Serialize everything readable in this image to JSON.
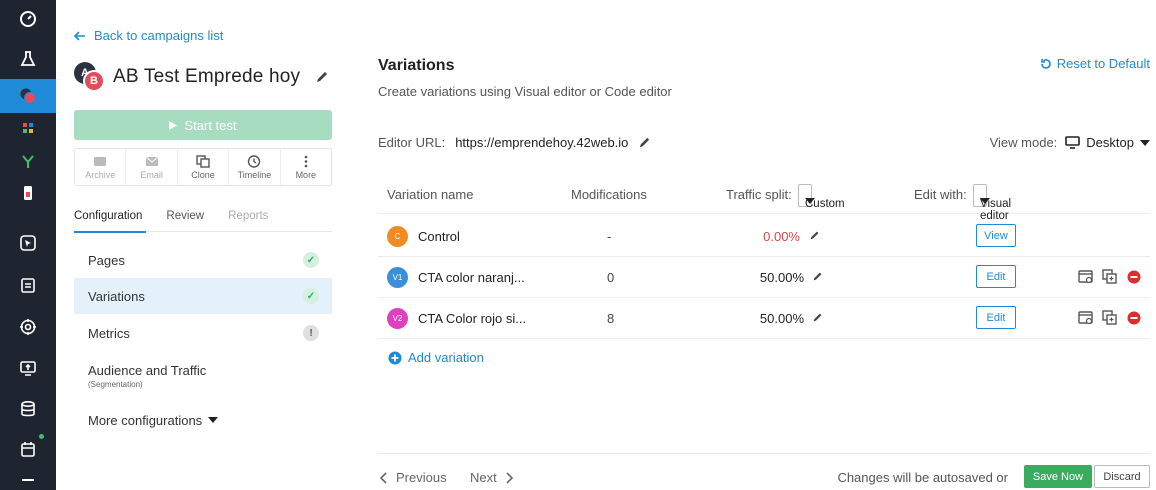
{
  "rail": {
    "items": [
      {
        "icon": "dashboard-icon"
      },
      {
        "icon": "flask-icon"
      },
      {
        "icon": "ab-test-icon"
      },
      {
        "icon": "grid-icon"
      },
      {
        "icon": "split-icon"
      },
      {
        "icon": "mobile-icon"
      },
      {
        "icon": "cursor-icon"
      },
      {
        "icon": "list-icon"
      },
      {
        "icon": "target-icon"
      },
      {
        "icon": "upload-screen-icon"
      },
      {
        "icon": "database-icon"
      },
      {
        "icon": "calendar-icon"
      }
    ]
  },
  "sidebar": {
    "back_label": "Back to campaigns list",
    "campaign_title": "AB Test Emprede hoy",
    "avatar_a": "A",
    "avatar_b": "B",
    "start_label": "Start test",
    "tools": [
      {
        "label": "Archive",
        "icon": "archive-icon"
      },
      {
        "label": "Email",
        "icon": "email-icon"
      },
      {
        "label": "Clone",
        "icon": "clone-icon"
      },
      {
        "label": "Timeline",
        "icon": "timeline-icon"
      },
      {
        "label": "More",
        "icon": "more-icon"
      }
    ],
    "tabs": [
      "Configuration",
      "Review",
      "Reports"
    ],
    "nav": [
      {
        "label": "Pages",
        "status": "complete"
      },
      {
        "label": "Variations",
        "status": "complete"
      },
      {
        "label": "Metrics",
        "status": "warning"
      },
      {
        "label": "Audience and Traffic",
        "sub": "(Segmentation)"
      },
      {
        "label": "More configurations"
      }
    ]
  },
  "main": {
    "title": "Variations",
    "subtitle": "Create variations using Visual editor or Code editor",
    "reset_label": "Reset to Default",
    "editor_url_label": "Editor URL:",
    "editor_url": "https://emprendehoy.42web.io",
    "view_mode_label": "View mode:",
    "view_mode_value": "Desktop",
    "table": {
      "col_name": "Variation name",
      "col_mods": "Modifications",
      "col_traffic": "Traffic split:",
      "traffic_mode": "Custom",
      "col_edit": "Edit with:",
      "edit_mode": "Visual editor",
      "rows": [
        {
          "badge": "C",
          "badge_color": "#f08a24",
          "name": "Control",
          "mods": "-",
          "traffic": "0.00%",
          "action": "View"
        },
        {
          "badge": "V1",
          "badge_color": "#3a8fd9",
          "name": "CTA color naranj...",
          "mods": "0",
          "traffic": "50.00%",
          "action": "Edit"
        },
        {
          "badge": "V2",
          "badge_color": "#e03fbf",
          "name": "CTA Color rojo si...",
          "mods": "8",
          "traffic": "50.00%",
          "action": "Edit"
        }
      ]
    },
    "add_variation": "Add variation",
    "footer": {
      "previous": "Previous",
      "next": "Next",
      "autosave": "Changes will be autosaved or",
      "save": "Save Now",
      "discard": "Discard"
    }
  },
  "colors": {
    "accent": "#1f8ad8",
    "success": "#3bab5f",
    "rail": "#1e2530",
    "danger": "#d9302f"
  }
}
